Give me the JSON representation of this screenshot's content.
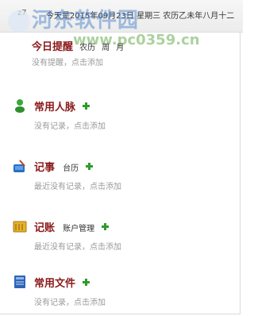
{
  "topbar": {
    "user": "z7",
    "date_text": "今天是2015年09月23日 星期三 农历乙未年八月十二"
  },
  "watermark": {
    "site_name": "河东软件园",
    "url": "www.pc0359.cn"
  },
  "sections": [
    {
      "title": "今日提醒",
      "links": [
        "农历",
        "周",
        "月"
      ],
      "empty_text": "没有提醒，点击添加"
    },
    {
      "title": "常用人脉",
      "links": [],
      "empty_text": "没有记录，点击添加"
    },
    {
      "title": "记事",
      "links": [
        "台历"
      ],
      "empty_text": "最近没有记录，点击添加"
    },
    {
      "title": "记账",
      "links": [
        "账户管理"
      ],
      "empty_text": "最近没有记录，点击添加"
    },
    {
      "title": "常用文件",
      "links": [],
      "empty_text": "没有记录，点击添加"
    }
  ],
  "colors": {
    "title": "#8a1a1a",
    "plus": "#2e9b2e",
    "muted": "#9a9a9a"
  }
}
